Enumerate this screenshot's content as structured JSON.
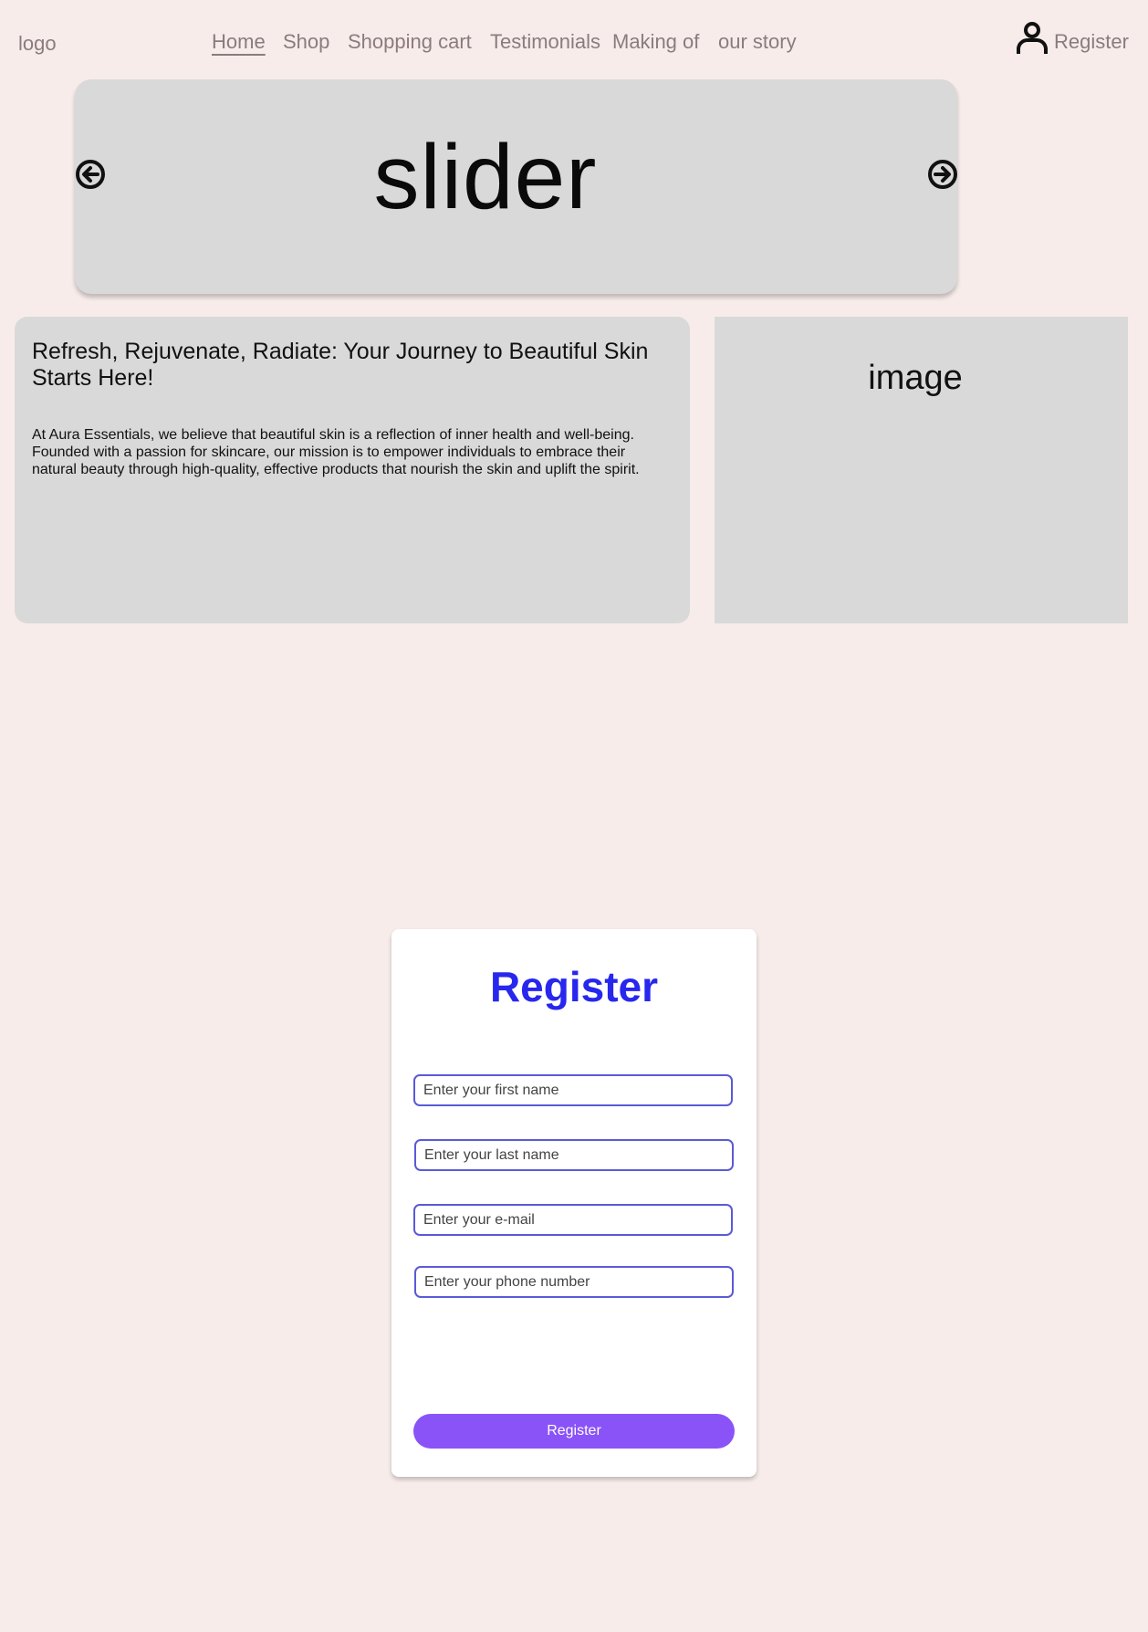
{
  "header": {
    "logo": "logo",
    "nav": [
      {
        "label": "Home"
      },
      {
        "label": "Shop"
      },
      {
        "label": "Shopping cart"
      },
      {
        "label": "Testimonials"
      },
      {
        "label": "Making of"
      },
      {
        "label": "our story"
      }
    ],
    "register_label": "Register",
    "user_icon": "user-icon"
  },
  "slider": {
    "label": "slider",
    "prev_icon": "arrow-left-circle-icon",
    "next_icon": "arrow-right-circle-icon"
  },
  "intro": {
    "heading": "Refresh, Rejuvenate, Radiate: Your Journey to Beautiful Skin Starts Here!",
    "body": "At Aura Essentials, we believe that beautiful skin is a reflection of inner health and well-being. Founded with a passion for skincare, our mission is to empower individuals to embrace their natural beauty through high-quality, effective products that nourish the skin and uplift the spirit."
  },
  "image_placeholder": {
    "label": "image"
  },
  "register_form": {
    "title": "Register",
    "fields": [
      {
        "placeholder": "Enter your first name",
        "value": ""
      },
      {
        "placeholder": "Enter your last name",
        "value": ""
      },
      {
        "placeholder": "Enter your e-mail",
        "value": ""
      },
      {
        "placeholder": "Enter your phone number",
        "value": ""
      }
    ],
    "submit_label": "Register"
  },
  "colors": {
    "page_background": "#f7ecea",
    "nav_text": "#8c7b7e",
    "placeholder_gray": "#d9d9d9",
    "register_title": "#2727ee",
    "input_border": "#5a5ad8",
    "button_purple": "#8a53f7"
  }
}
